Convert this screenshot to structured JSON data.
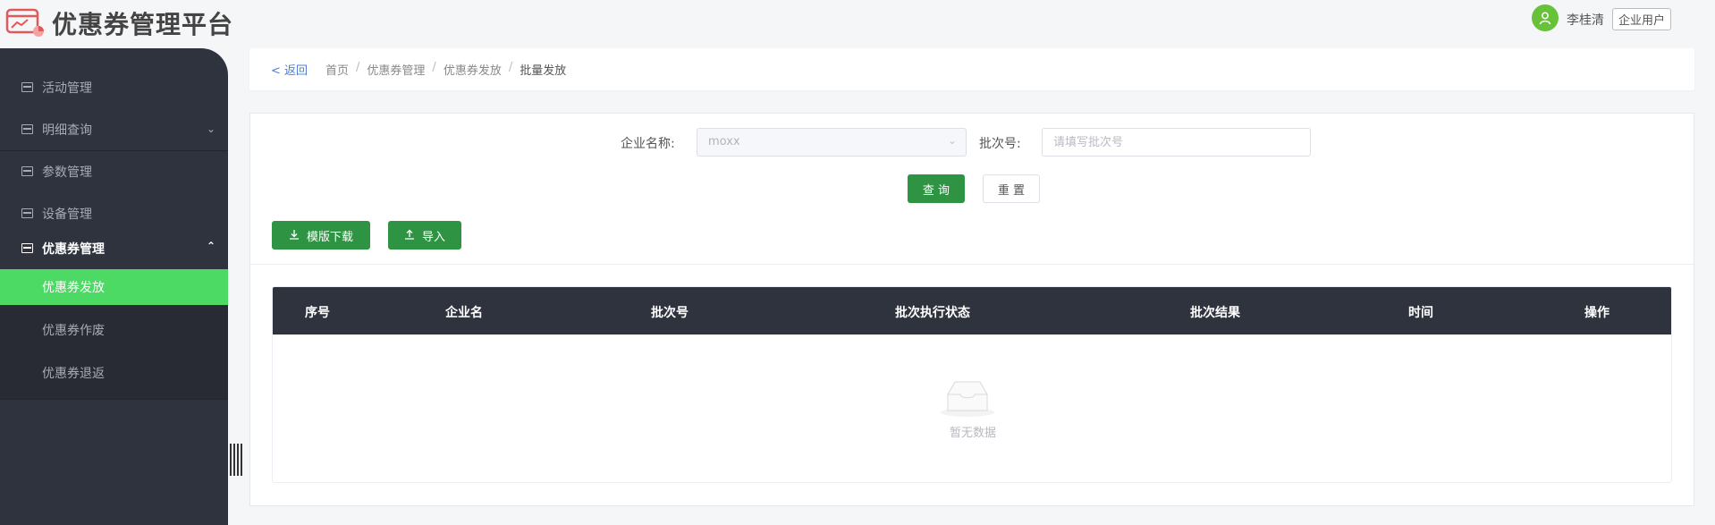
{
  "header": {
    "title": "优惠券管理平台",
    "user_name": "李桂清",
    "user_role": "企业用户"
  },
  "sidebar": {
    "items": [
      {
        "label": "活动管理"
      },
      {
        "label": "明细查询"
      },
      {
        "label": "参数管理"
      },
      {
        "label": "设备管理"
      },
      {
        "label": "优惠券管理"
      }
    ],
    "sub_items": [
      {
        "label": "优惠券发放"
      },
      {
        "label": "优惠券作废"
      },
      {
        "label": "优惠券退返"
      }
    ]
  },
  "breadcrumb": {
    "back": "< 返回",
    "items": [
      "首页",
      "优惠券管理",
      "优惠券发放",
      "批量发放"
    ]
  },
  "form": {
    "company_label": "企业名称:",
    "company_value": "moxx",
    "batch_label": "批次号:",
    "batch_placeholder": "请填写批次号",
    "query_button": "查 询",
    "reset_button": "重 置",
    "template_button": "模版下载",
    "import_button": "导入"
  },
  "table": {
    "columns": [
      "序号",
      "企业名",
      "批次号",
      "批次执行状态",
      "批次结果",
      "时间",
      "操作"
    ],
    "empty_text": "暂无数据"
  },
  "colors": {
    "sidebar_bg": "#2f333d",
    "active_green": "#4cd964",
    "button_green": "#2e9443",
    "link_blue": "#4a7fd6"
  }
}
